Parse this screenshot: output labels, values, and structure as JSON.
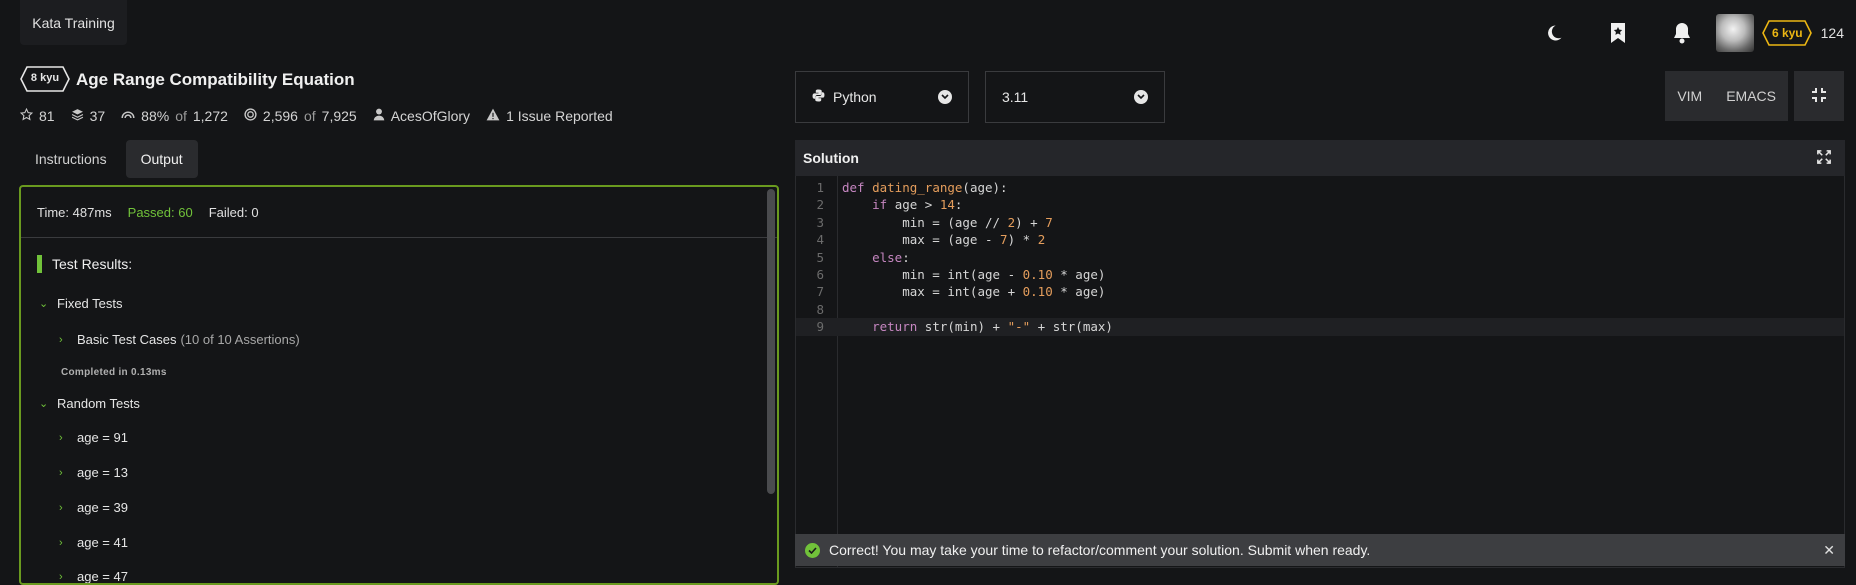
{
  "brand": {
    "label": "Kata Training"
  },
  "user": {
    "rank": "6 kyu",
    "honor": "124"
  },
  "kata": {
    "rank": "8 kyu",
    "title": "Age Range Compatibility Equation",
    "stars": "81",
    "collections": "37",
    "satisfaction_pct": "88%",
    "satisfaction_of": "of",
    "satisfaction_total": "1,272",
    "completed": "2,596",
    "completed_of": "of",
    "completed_total": "7,925",
    "author": "AcesOfGlory",
    "issues": "1 Issue Reported"
  },
  "tabs": [
    {
      "label": "Instructions",
      "active": false
    },
    {
      "label": "Output",
      "active": true
    }
  ],
  "output": {
    "time": "Time: 487ms",
    "passed": "Passed: 60",
    "failed": "Failed: 0",
    "results_title": "Test Results:",
    "fixed_group": "Fixed Tests",
    "basic_case": "Basic Test Cases",
    "basic_assertions": "(10 of 10 Assertions)",
    "completed": "Completed in 0.13ms",
    "random_group": "Random Tests",
    "random_cases": [
      "age = 91",
      "age = 13",
      "age = 39",
      "age = 41",
      "age = 47"
    ]
  },
  "language": {
    "selected": "Python"
  },
  "version": {
    "selected": "3.11"
  },
  "modes": [
    "VIM",
    "EMACS"
  ],
  "editor": {
    "title": "Solution",
    "line_numbers": [
      "1",
      "2",
      "3",
      "4",
      "5",
      "6",
      "7",
      "8",
      "9"
    ]
  },
  "alert": {
    "message": "Correct! You may take your time to refactor/comment your solution. Submit when ready."
  },
  "colors": {
    "pass": "#71c23a",
    "border": "#6a9a1f",
    "kyu_yellow": "#ecb613"
  }
}
